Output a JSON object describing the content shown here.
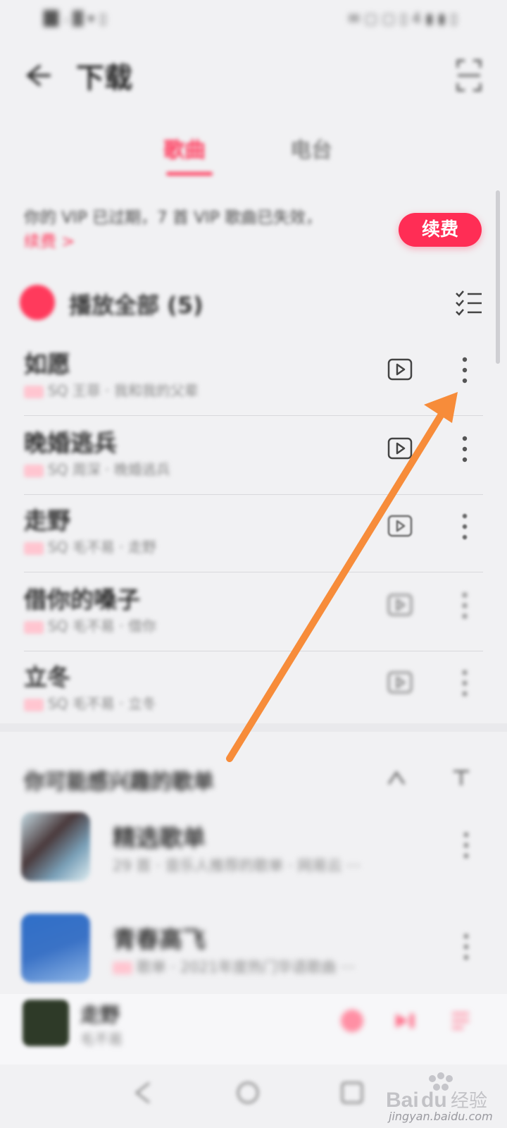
{
  "status_bar": {
    "left_text": "█▍ᵢ ▓ ▾ ▯",
    "right_text": "✉ ▢ ▢ ▯ 4 ▮ ▮ ▯"
  },
  "header": {
    "title": "下载",
    "back_icon": "back-arrow-icon",
    "right_icon": "scan-icon"
  },
  "tabs": [
    {
      "label": "歌曲",
      "active": true
    },
    {
      "label": "电台",
      "active": false
    }
  ],
  "vip_banner": {
    "notice": "你的 VIP 已过期，7 首 VIP 歌曲已失效，",
    "link": "续费 >",
    "renew_label": "续费"
  },
  "play_all": {
    "label": "播放全部 (5)"
  },
  "songs": [
    {
      "title": "如愿",
      "subtitle": "SQ  王菲 · 我和我的父辈"
    },
    {
      "title": "晚婚逃兵",
      "subtitle": "SQ  周深 · 晚婚逃兵"
    },
    {
      "title": "走野",
      "subtitle": "SQ  毛不易 · 走野"
    },
    {
      "title": "借你的嗓子",
      "subtitle": "SQ  毛不易 · 借你"
    },
    {
      "title": "立冬",
      "subtitle": "SQ  毛不易 · 立冬"
    }
  ],
  "recommend": {
    "title": "你可能感兴趣的歌单"
  },
  "playlists": [
    {
      "title": "精选歌单",
      "subtitle": "29  首 · 音乐人推荐的歌单 · 网易云 ···"
    },
    {
      "title": "青春高飞",
      "subtitle": "歌单 · 2021年度热门华语歌曲 ···"
    }
  ],
  "mini_player": {
    "title": "走野",
    "artist": "毛不易"
  },
  "watermark": {
    "brand": "Baidu经验",
    "url": "jingyan.baidu.com"
  },
  "colors": {
    "accent": "#ff3a5c",
    "arrow": "#f78c3a",
    "background": "#f1f1f3"
  }
}
